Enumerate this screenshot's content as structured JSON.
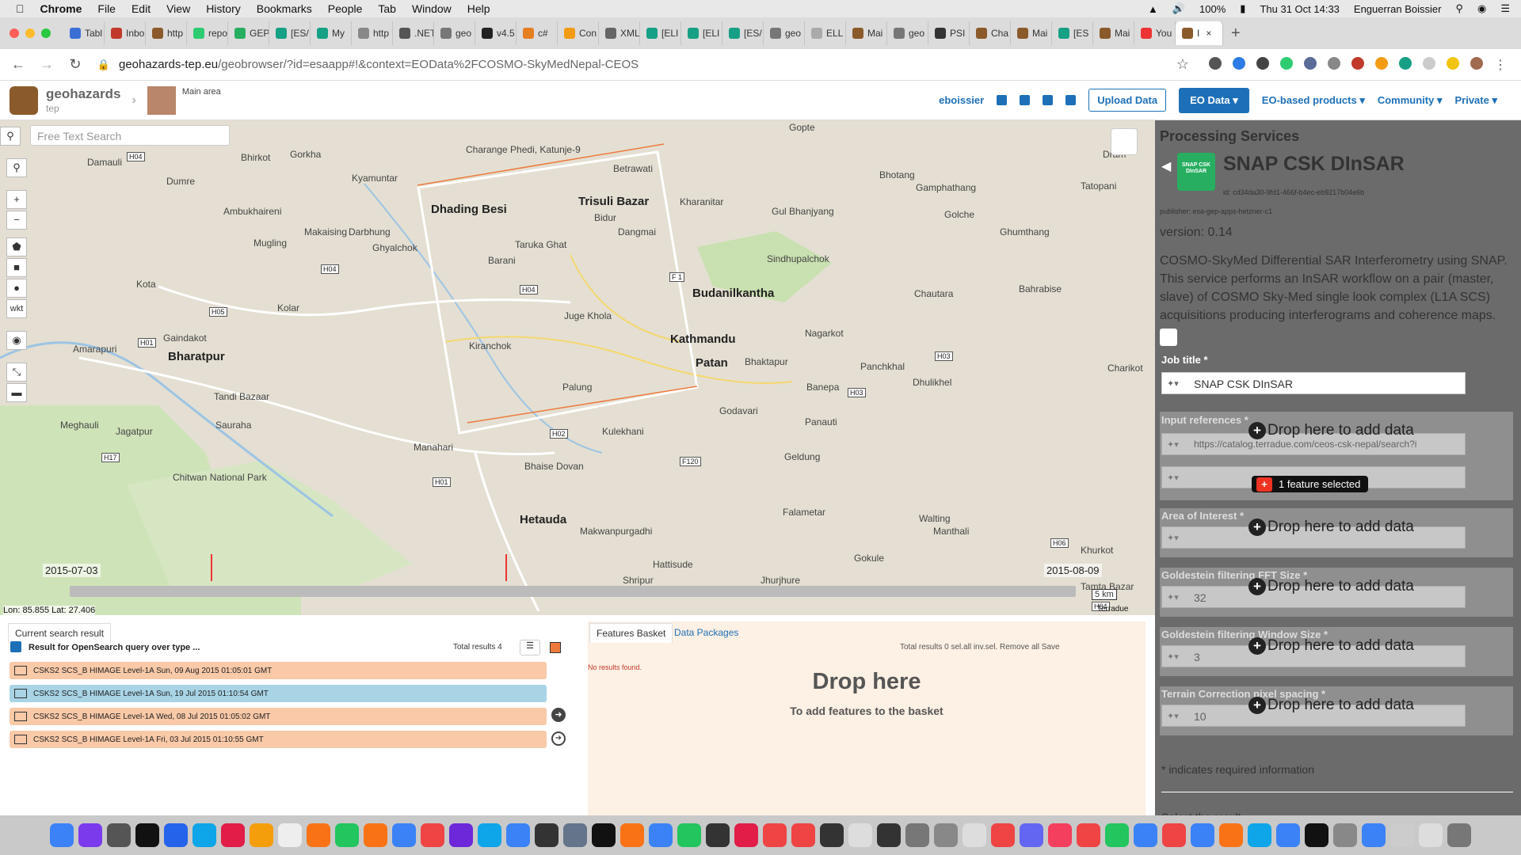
{
  "os": {
    "menubar": {
      "app_name": "Chrome",
      "menus": [
        "File",
        "Edit",
        "View",
        "History",
        "Bookmarks",
        "People",
        "Tab",
        "Window",
        "Help"
      ],
      "battery": "100%",
      "datetime": "Thu 31 Oct  14:33",
      "user": "Enguerran Boissier"
    }
  },
  "browser": {
    "tabs": [
      "Tabl",
      "Inbo",
      "http",
      "repo",
      "GEP",
      "[ES/",
      "My",
      "http",
      ".NET",
      "geo",
      "v4.5",
      "c#",
      "Con",
      "XML",
      "[ELI",
      "[ELI",
      "[ES/",
      "geo",
      "ELL",
      "Mai",
      "geo",
      "PSI",
      "Cha",
      "Mai",
      "[ES",
      "Mai",
      "You",
      "I"
    ],
    "url_host": "geohazards-tep.eu",
    "url_path": "/geobrowser/?id=esaapp#!&context=EOData%2FCOSMO-SkyMedNepal-CEOS"
  },
  "header": {
    "brand_name": "geohazards",
    "brand_sub": "tep",
    "breadcrumb": "Main area",
    "user": "eboissier",
    "upload_label": "Upload Data",
    "nav": [
      "EO Data",
      "EO-based products",
      "Community",
      "Private"
    ]
  },
  "map": {
    "search_placeholder": "Free Text Search",
    "tool_wkt": "wkt",
    "places": [
      {
        "n": "Damauli"
      },
      {
        "n": "Dumre"
      },
      {
        "n": "Bhirkot"
      },
      {
        "n": "Gorkha"
      },
      {
        "n": "Charange Phedi, Katunje-9"
      },
      {
        "n": "Kyamuntar"
      },
      {
        "n": "Betrawati"
      },
      {
        "n": "Gopte"
      },
      {
        "n": "Dram"
      },
      {
        "n": "Tatopani"
      },
      {
        "n": "Dhading Besi"
      },
      {
        "n": "Trisuli Bazar"
      },
      {
        "n": "Bidur"
      },
      {
        "n": "Kharanitar"
      },
      {
        "n": "Gul Bhanjyang"
      },
      {
        "n": "Bhotang"
      },
      {
        "n": "Gamphathang"
      },
      {
        "n": "Ambukhaireni"
      },
      {
        "n": "Makaising"
      },
      {
        "n": "Darbhung"
      },
      {
        "n": "Dangmai"
      },
      {
        "n": "Taruka Ghat"
      },
      {
        "n": "Sindhupalchok"
      },
      {
        "n": "Golche"
      },
      {
        "n": "Ghumthang"
      },
      {
        "n": "Mugling"
      },
      {
        "n": "Ghyalchok"
      },
      {
        "n": "Barani"
      },
      {
        "n": "Budanilkantha"
      },
      {
        "n": "Kota"
      },
      {
        "n": "Kolar"
      },
      {
        "n": "Juge Khola"
      },
      {
        "n": "Chautara"
      },
      {
        "n": "Bahrabise"
      },
      {
        "n": "Amarapuri"
      },
      {
        "n": "Gaindakot"
      },
      {
        "n": "Bharatpur"
      },
      {
        "n": "Kiranchok"
      },
      {
        "n": "Kathmandu"
      },
      {
        "n": "Patan"
      },
      {
        "n": "Bhaktapur"
      },
      {
        "n": "Nagarkot"
      },
      {
        "n": "Panchkhal"
      },
      {
        "n": "Charikot"
      },
      {
        "n": "Tandi Bazaar"
      },
      {
        "n": "Meghauli"
      },
      {
        "n": "Jagatpur"
      },
      {
        "n": "Sauraha"
      },
      {
        "n": "Palung"
      },
      {
        "n": "Godavari"
      },
      {
        "n": "Banepa"
      },
      {
        "n": "Panauti"
      },
      {
        "n": "Dhulikhel"
      },
      {
        "n": "Manahari"
      },
      {
        "n": "Kulekhani"
      },
      {
        "n": "Bhaise Dovan"
      },
      {
        "n": "Chitwan National Park"
      },
      {
        "n": "Hetauda"
      },
      {
        "n": "Makwanpurgadhi"
      },
      {
        "n": "Geldung"
      },
      {
        "n": "Falametar"
      },
      {
        "n": "Walting"
      },
      {
        "n": "Hattisude"
      },
      {
        "n": "Shripur"
      },
      {
        "n": "Jhurjhure"
      },
      {
        "n": "Gokule"
      },
      {
        "n": "Manthali"
      },
      {
        "n": "Khurkot"
      },
      {
        "n": "Tamta Bazar"
      }
    ],
    "timeline": {
      "start": "2015-07-03",
      "end": "2015-08-09"
    },
    "coords": "Lon: 85.855 Lat: 27.406",
    "scale": "5 km",
    "attribution": "Terradue"
  },
  "results": {
    "tab_label": "Current search result",
    "title": "Result for OpenSearch query over type ...",
    "total": "Total results  4",
    "rows": [
      {
        "label": "CSKS2 SCS_B HIMAGE Level-1A Sun, 09 Aug 2015 01:05:01 GMT",
        "color": "#f9c9a8"
      },
      {
        "label": "CSKS2 SCS_B HIMAGE Level-1A Sun, 19 Jul 2015 01:10:54 GMT",
        "color": "#a8d4e6"
      },
      {
        "label": "CSKS2 SCS_B HIMAGE Level-1A Wed, 08 Jul 2015 01:05:02 GMT",
        "color": "#f9c9a8"
      },
      {
        "label": "CSKS2 SCS_B HIMAGE Level-1A Fri, 03 Jul 2015 01:10:55 GMT",
        "color": "#f9c9a8"
      }
    ]
  },
  "basket": {
    "tab1": "Features Basket",
    "tab2": "Data Packages",
    "toolbar": "Total results  0   sel.all   inv.sel.   Remove all   Save",
    "no_results": "No results found.",
    "drop_title": "Drop here",
    "drop_sub": "To add features to the basket"
  },
  "panel": {
    "section_title": "Processing Services",
    "service_icon_text": "SNAP CSK DInSAR",
    "service_name": "SNAP CSK DInSAR",
    "service_id": "id: cd34da30-9fd1-466f-b4ec-eb9217b04e6b",
    "publisher": "publisher: esa-gep-apps-hetzner-c1",
    "version": "version: 0.14",
    "description": "COSMO-SkyMed Differential SAR Interferometry using SNAP. This service performs an InSAR workflow on a pair (master, slave) of COSMO Sky-Med single look complex (L1A SCS) acquisitions producing interferograms and coherence maps.",
    "job_title_label": "Job title *",
    "job_title_value": "SNAP CSK DInSAR",
    "input_ref_label": "Input references *",
    "input_ref_value": "https://catalog.terradue.com/ceos-csk-nepal/search?i",
    "feature_selected": "1 feature selected",
    "aoi_label": "Area of Interest *",
    "fft_label": "Goldestein filtering FFT Size *",
    "fft_value": "32",
    "window_label": "Goldestein filtering Window Size *",
    "window_value": "3",
    "terrain_label": "Terrain Correction pixel spacing *",
    "terrain_value": "10",
    "drop_text": "Drop here to add data",
    "required_note": "* indicates required information",
    "select_result": "Select the result"
  }
}
